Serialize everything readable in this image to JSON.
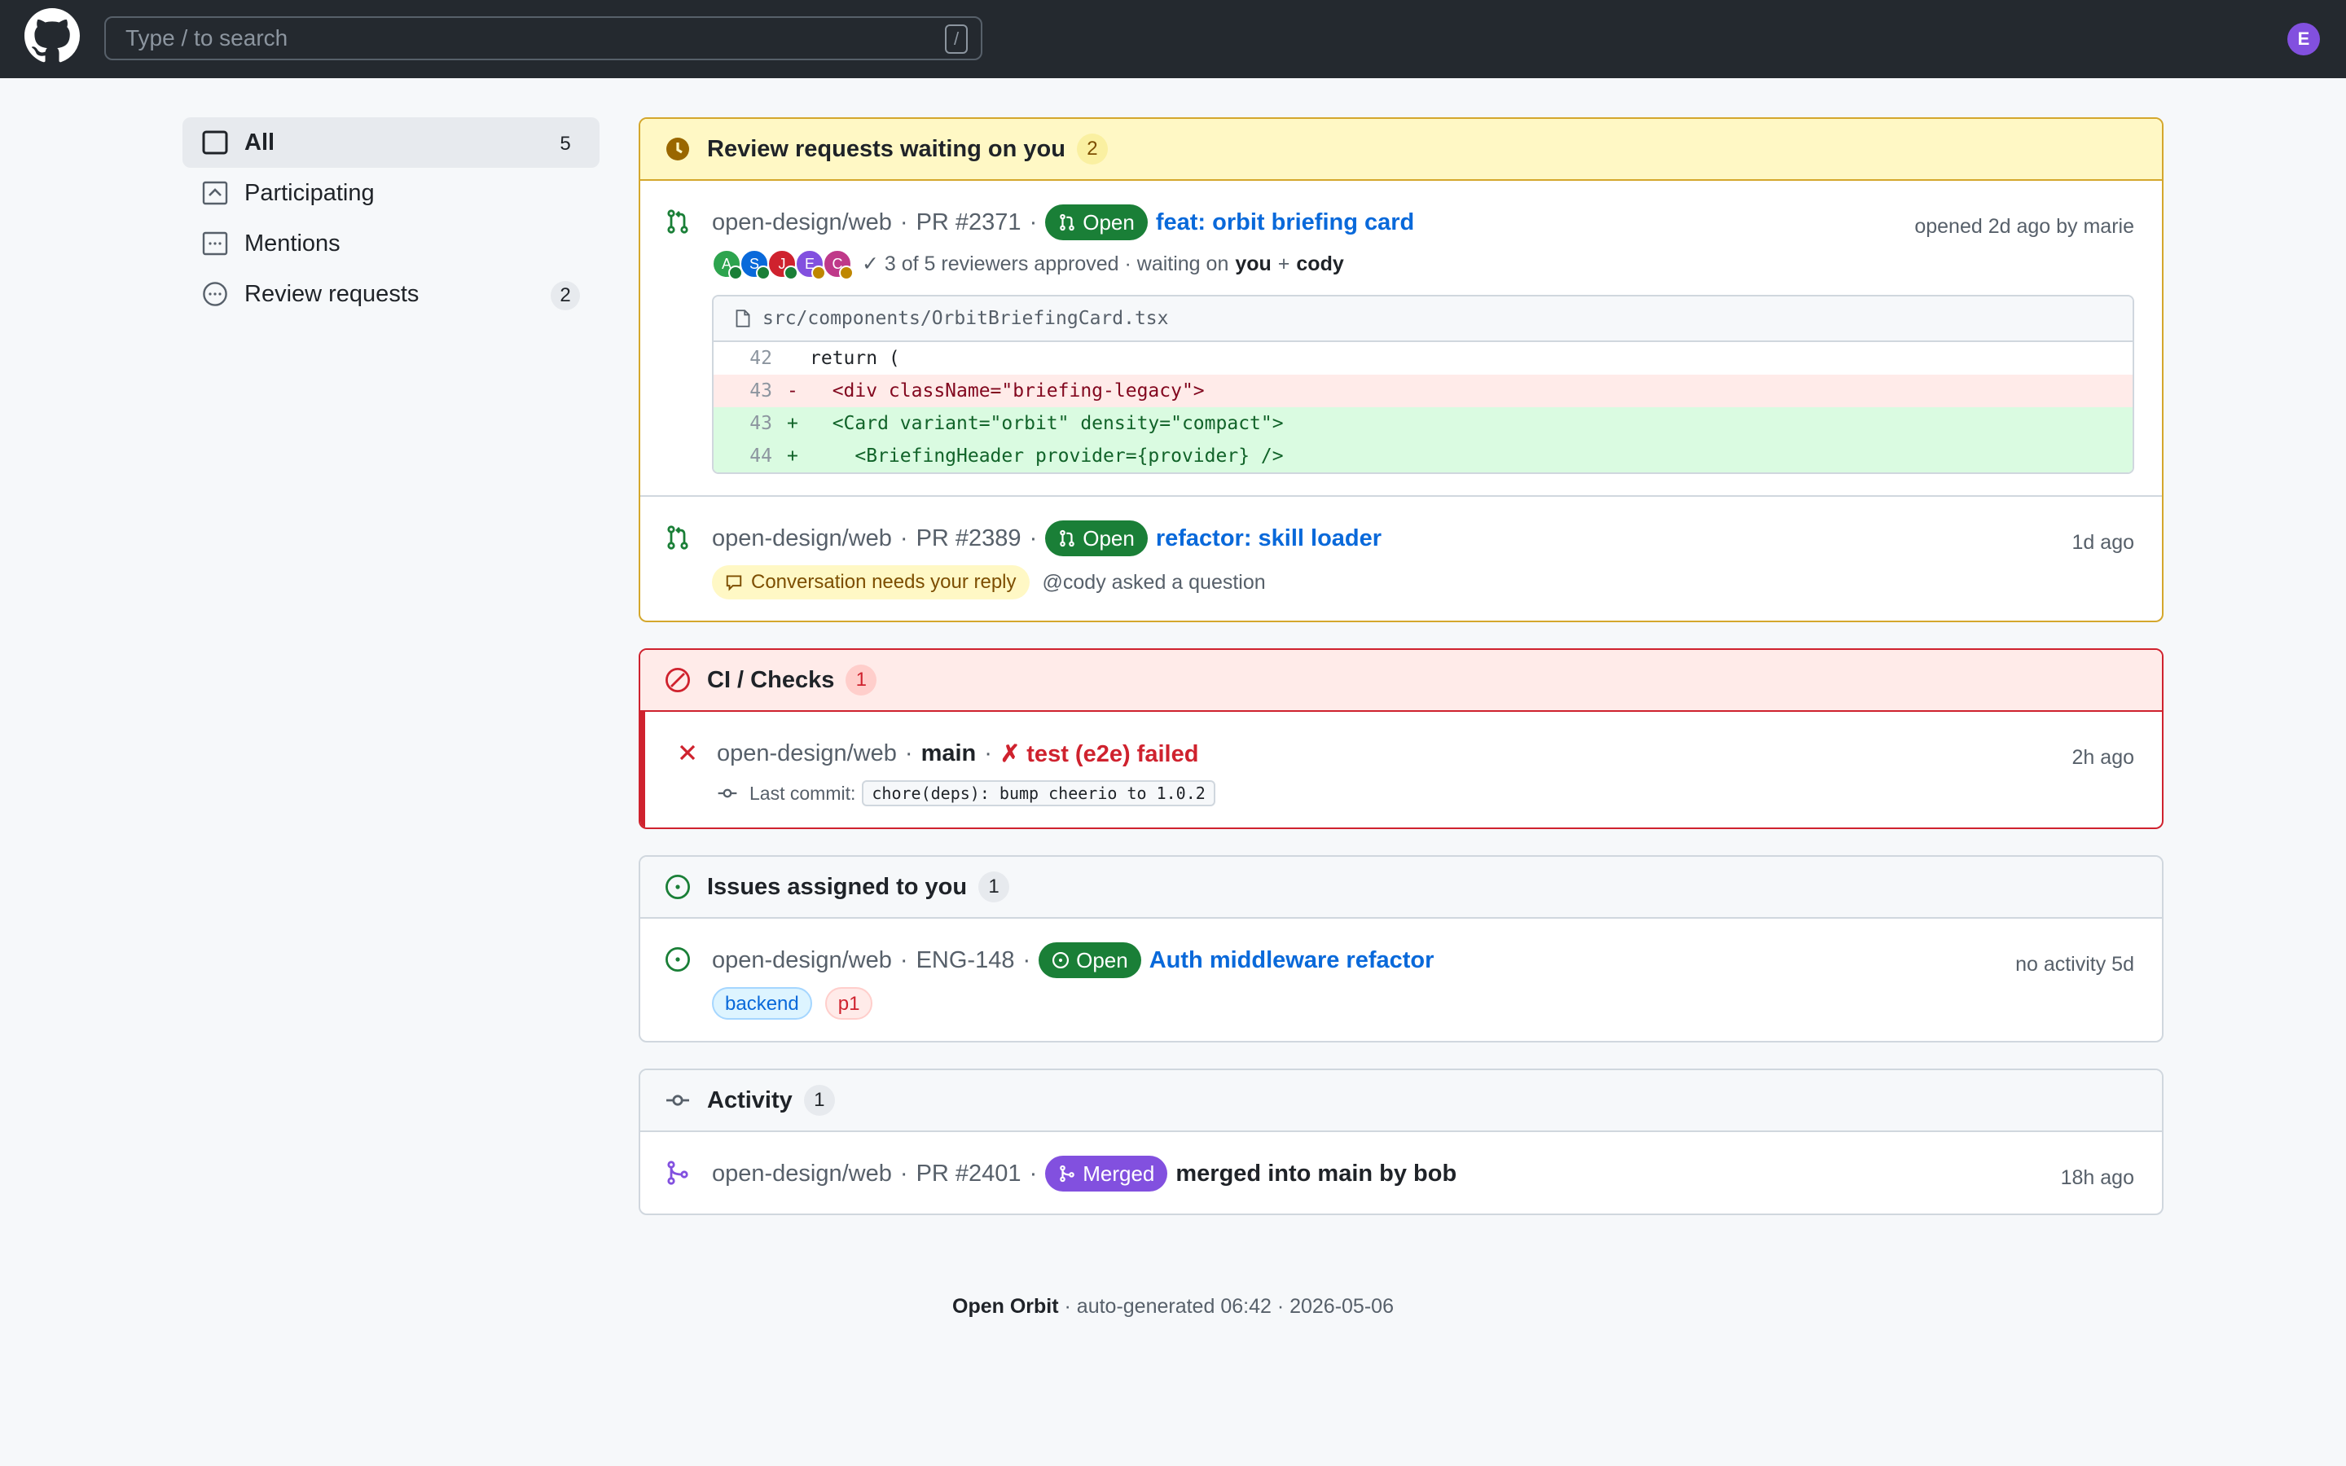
{
  "topbar": {
    "search_placeholder": "Type / to search",
    "search_shortcut": "/",
    "user_initial": "E"
  },
  "sidebar": {
    "items": [
      {
        "label": "All",
        "count": "5",
        "icon": "inbox-icon"
      },
      {
        "label": "Participating",
        "count": "",
        "icon": "participating-icon"
      },
      {
        "label": "Mentions",
        "count": "",
        "icon": "mention-icon"
      },
      {
        "label": "Review requests",
        "count": "2",
        "icon": "review-icon"
      }
    ]
  },
  "review": {
    "title": "Review requests waiting on you",
    "count": "2",
    "items": [
      {
        "repo": "open-design/web",
        "number": "PR #2371",
        "status": "Open",
        "title": "feat: orbit briefing card",
        "time": "opened 2d ago by marie",
        "reviewers": [
          "A",
          "S",
          "J",
          "E",
          "C"
        ],
        "approvals": "✓ 3 of 5 reviewers approved · waiting on",
        "waiting_you": "you",
        "plus": "+",
        "waiting_other": "cody",
        "diff": {
          "file": "src/components/OrbitBriefingCard.tsx",
          "lines": [
            {
              "ln": "42",
              "sign": "",
              "code": "return (",
              "type": "ctx"
            },
            {
              "ln": "43",
              "sign": "-",
              "code": "  <div className=\"briefing-legacy\">",
              "type": "del"
            },
            {
              "ln": "43",
              "sign": "+",
              "code": "  <Card variant=\"orbit\" density=\"compact\">",
              "type": "add"
            },
            {
              "ln": "44",
              "sign": "+",
              "code": "    <BriefingHeader provider={provider} />",
              "type": "add"
            }
          ]
        }
      },
      {
        "repo": "open-design/web",
        "number": "PR #2389",
        "status": "Open",
        "title": "refactor: skill loader",
        "time": "1d ago",
        "conversation": "Conversation needs your reply",
        "note": "@cody asked a question"
      }
    ]
  },
  "ci": {
    "title": "CI / Checks",
    "count": "1",
    "repo": "open-design/web",
    "branch": "main",
    "failure": "✗ test (e2e) failed",
    "time": "2h ago",
    "commit_label": "Last commit:",
    "commit_msg": "chore(deps): bump cheerio to 1.0.2"
  },
  "issues": {
    "title": "Issues assigned to you",
    "count": "1",
    "repo": "open-design/web",
    "number": "ENG-148",
    "status": "Open",
    "issue_title": "Auth middleware refactor",
    "time": "no activity 5d",
    "labels": [
      "backend",
      "p1"
    ]
  },
  "activity": {
    "title": "Activity",
    "count": "1",
    "repo": "open-design/web",
    "number": "PR #2401",
    "status": "Merged",
    "text": "merged into main by bob",
    "time": "18h ago"
  },
  "footer": {
    "brand": "Open Orbit",
    "text": "· auto-generated 06:42 · 2026-05-06"
  },
  "colors": {
    "open": "#1a7f37",
    "merged": "#8250df",
    "fail": "#cf222e",
    "link": "#0969da",
    "review_bg": "#fff8c5"
  }
}
